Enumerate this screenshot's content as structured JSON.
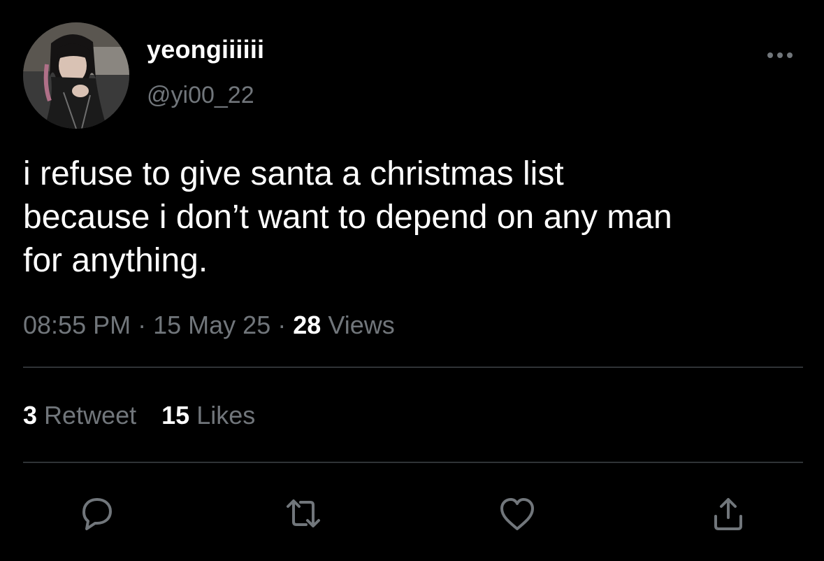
{
  "author": {
    "display_name": "yeongiiiiii",
    "handle": "@yi00_22",
    "avatar_icon": "profile-photo"
  },
  "tweet": {
    "text": "i refuse to give santa a christmas list\nbecause i don’t want to depend on any man\nfor anything."
  },
  "meta": {
    "time": "08:55 PM",
    "separator": "·",
    "date": "15 May 25",
    "views_count": "28",
    "views_label": "Views"
  },
  "stats": {
    "retweets_count": "3",
    "retweets_label": "Retweet",
    "likes_count": "15",
    "likes_label": "Likes"
  },
  "actions": [
    {
      "icon": "reply-icon"
    },
    {
      "icon": "retweet-icon"
    },
    {
      "icon": "like-heart-icon"
    },
    {
      "icon": "share-icon"
    }
  ],
  "more_icon": "more-dots-icon",
  "colors": {
    "background": "#000000",
    "text_primary": "#ffffff",
    "text_secondary": "#71767b",
    "divider": "#2f3336"
  }
}
